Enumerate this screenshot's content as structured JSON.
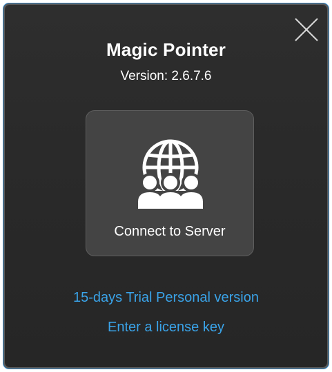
{
  "app": {
    "title": "Magic Pointer",
    "version": "Version: 2.6.7.6"
  },
  "connect": {
    "label": "Connect to Server",
    "icon": "globe-users-icon"
  },
  "links": {
    "trial": "15-days Trial Personal version",
    "license": "Enter a license key"
  },
  "close": {
    "icon": "close-icon"
  },
  "colors": {
    "background": "#2a2a2a",
    "button": "#444444",
    "link": "#3aa3e8",
    "accent_border": "#2f86c9",
    "text": "#ffffff"
  }
}
